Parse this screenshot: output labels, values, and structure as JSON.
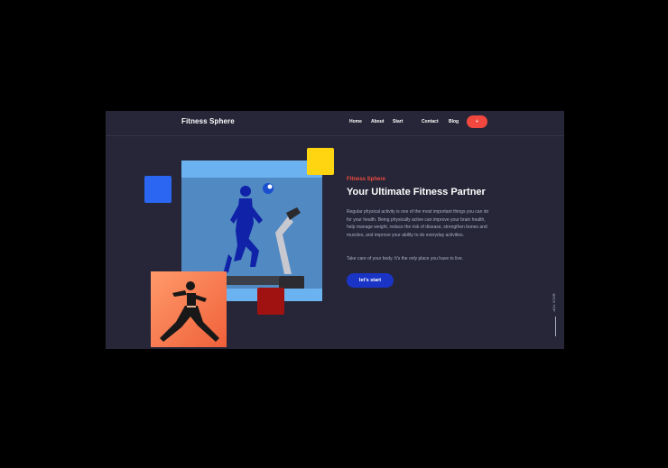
{
  "header": {
    "brand": "Fitness Sphere",
    "nav": [
      "Home",
      "About",
      "Start",
      "Contact",
      "Blog"
    ],
    "cta_icon": "plus-icon",
    "cta_symbol": "+"
  },
  "hero": {
    "eyebrow": "Fitness Sphere",
    "title": "Your Ultimate Fitness Partner",
    "body": "Regular physical activity is one of the most important things you can do for your health. Being physically active can improve your brain health, help manage weight, reduce the risk of disease, strengthen bones and muscles, and improve your ability to do everyday activities.",
    "note": "Take care of your body. It's the only place you have to live.",
    "button": "let's start"
  },
  "back_top": "BACK TOP",
  "colors": {
    "background": "#262638",
    "accent_red": "#f04a3e",
    "button_blue": "#1a35c6",
    "square_yellow": "#ffd410",
    "square_blue": "#2a66f2",
    "square_red": "#a01212"
  }
}
